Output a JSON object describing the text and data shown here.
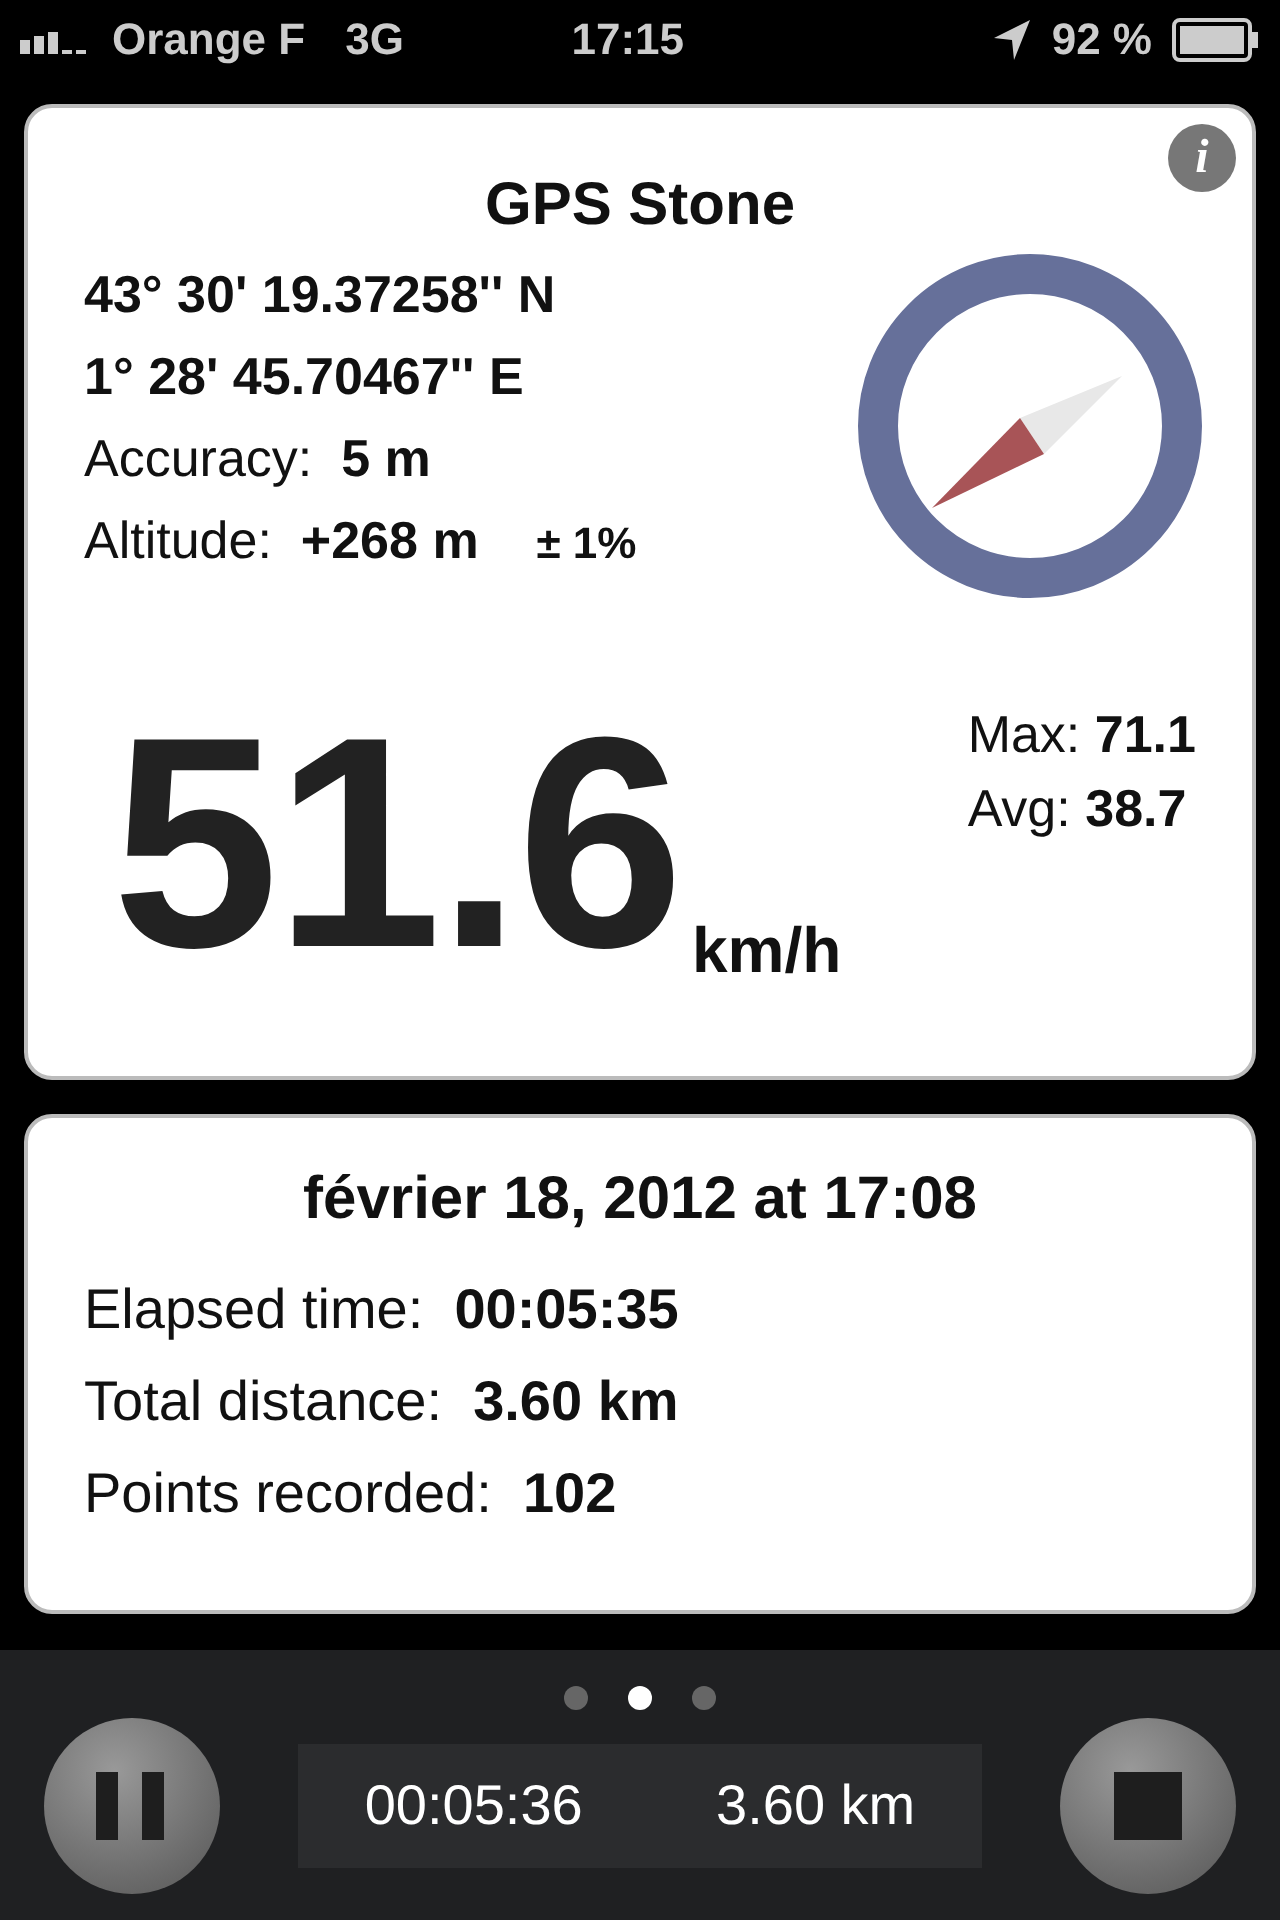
{
  "status_bar": {
    "carrier": "Orange F",
    "network": "3G",
    "time": "17:15",
    "battery": "92 %"
  },
  "gps_card": {
    "info_icon": "i",
    "title": "GPS Stone",
    "latitude": "43° 30' 19.37258'' N",
    "longitude": "1° 28' 45.70467'' E",
    "accuracy": {
      "label": "Accuracy:",
      "value": "5 m"
    },
    "altitude": {
      "label": "Altitude:",
      "value": "+268 m",
      "tolerance": "± 1%"
    },
    "speed": "51.6",
    "unit": "km/h",
    "max": {
      "label": "Max:",
      "value": "71.1"
    },
    "avg": {
      "label": "Avg:",
      "value": "38.7"
    }
  },
  "session_card": {
    "title": "février 18, 2012 at 17:08",
    "stats": [
      {
        "label": "Elapsed time:",
        "value": "00:05:35"
      },
      {
        "label": "Total distance:",
        "value": "3.60 km"
      },
      {
        "label": "Points recorded:",
        "value": "102"
      }
    ]
  },
  "page_dots": [
    {
      "selected": false
    },
    {
      "selected": true
    },
    {
      "selected": false
    }
  ],
  "bottom_bar": {
    "time": "00:05:36",
    "distance": "3.60 km"
  }
}
